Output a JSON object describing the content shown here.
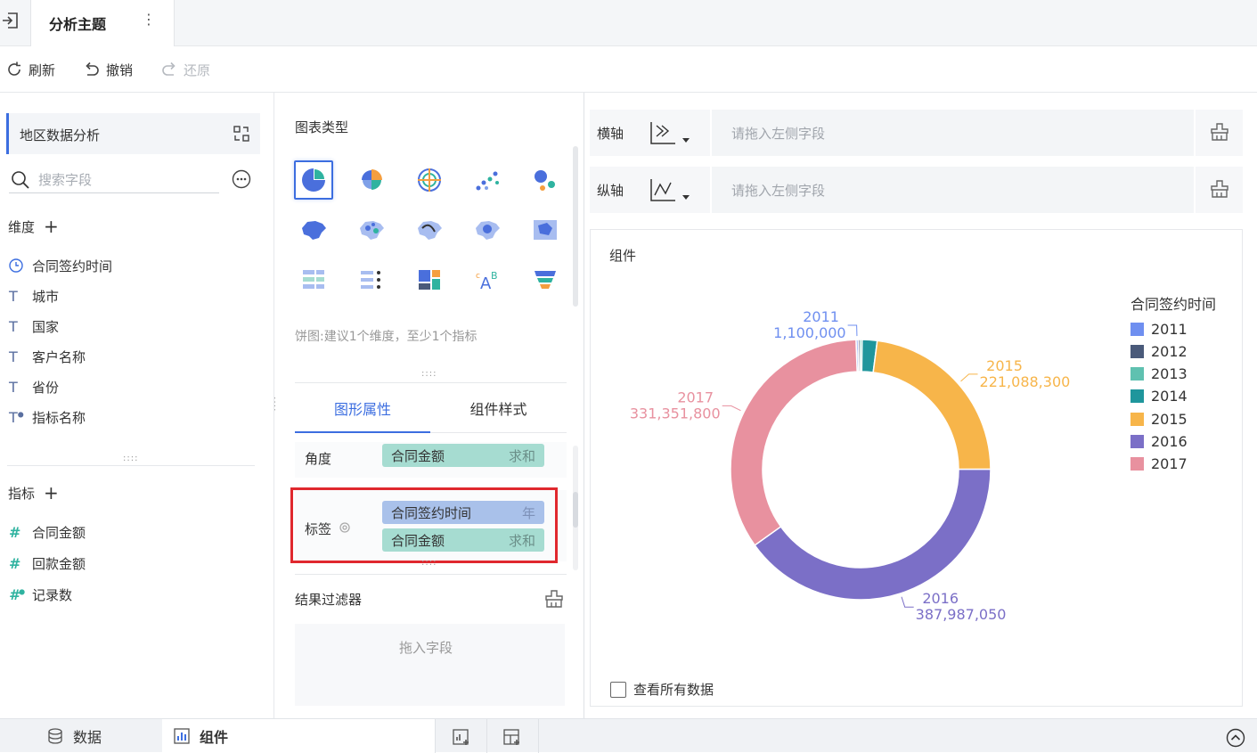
{
  "titlebar": {
    "title": "分析主题"
  },
  "toolbar": {
    "refresh": "刷新",
    "undo": "撤销",
    "redo": "还原"
  },
  "left": {
    "dataset_name": "地区数据分析",
    "search_placeholder": "搜索字段",
    "dimensions_title": "维度",
    "dimensions": [
      {
        "label": "合同签约时间",
        "icon": "clock-icon"
      },
      {
        "label": "城市",
        "icon": "text-type-icon"
      },
      {
        "label": "国家",
        "icon": "text-type-icon"
      },
      {
        "label": "客户名称",
        "icon": "text-type-icon"
      },
      {
        "label": "省份",
        "icon": "text-type-icon"
      },
      {
        "label": "指标名称",
        "icon": "text-type-calc-icon"
      }
    ],
    "measures_title": "指标",
    "measures": [
      {
        "label": "合同金额",
        "icon": "number-icon"
      },
      {
        "label": "回款金额",
        "icon": "number-icon"
      },
      {
        "label": "记录数",
        "icon": "number-calc-icon"
      }
    ]
  },
  "middle": {
    "chart_type_title": "图表类型",
    "hint": "饼图:建议1个维度，至少1个指标",
    "tabs": {
      "graph_props": "图形属性",
      "component_style": "组件样式"
    },
    "angle_label": "角度",
    "angle_field": {
      "name": "合同金额",
      "agg": "求和"
    },
    "tag_label": "标签",
    "tag_fields": [
      {
        "name": "合同签约时间",
        "agg": "年"
      },
      {
        "name": "合同金额",
        "agg": "求和"
      }
    ],
    "filter_title": "结果过滤器",
    "filter_drop": "拖入字段"
  },
  "axes": {
    "x_label": "横轴",
    "y_label": "纵轴",
    "x_placeholder": "请拖入左侧字段",
    "y_placeholder": "请拖入左侧字段"
  },
  "chart": {
    "card_title": "组件",
    "view_all": "查看所有数据"
  },
  "chart_data": {
    "type": "pie",
    "legend_title": "合同签约时间",
    "legend_position": "right",
    "donut": true,
    "slices": [
      {
        "label": "2011",
        "value": 1100000,
        "value_text": "1,100,000",
        "color": "#6f8ff0"
      },
      {
        "label": "2012",
        "value": 0,
        "value_text": "",
        "color": "#4a5a7a"
      },
      {
        "label": "2013",
        "value": 0,
        "value_text": "",
        "color": "#5fc1b0"
      },
      {
        "label": "2014",
        "value": 18000000,
        "value_text": "",
        "color": "#1f969c"
      },
      {
        "label": "2015",
        "value": 221088300,
        "value_text": "221,088,300",
        "color": "#f7b54a"
      },
      {
        "label": "2016",
        "value": 387987050,
        "value_text": "387,987,050",
        "color": "#7b6fc7"
      },
      {
        "label": "2017",
        "value": 331351800,
        "value_text": "331,351,800",
        "color": "#e8919f"
      }
    ]
  },
  "bottom": {
    "data_tab": "数据",
    "component_tab": "组件"
  }
}
